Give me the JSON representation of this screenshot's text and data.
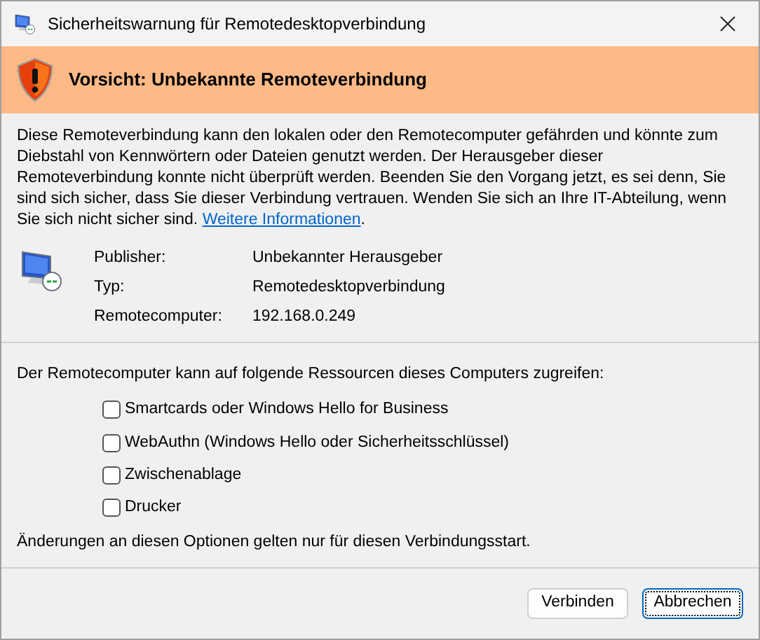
{
  "window": {
    "title": "Sicherheitswarnung für Remotedesktopverbindung"
  },
  "banner": {
    "text": "Vorsicht: Unbekannte Remoteverbindung"
  },
  "description": {
    "text": "Diese Remoteverbindung kann den lokalen oder den Remotecomputer gefährden und könnte zum Diebstahl von Kennwörtern oder Dateien genutzt werden. Der Herausgeber dieser Remoteverbindung konnte nicht überprüft werden. Beenden Sie den Vorgang jetzt, es sei denn, Sie sind sich sicher, dass Sie dieser Verbindung vertrauen. Wenden Sie sich an Ihre IT-Abteilung, wenn Sie sich nicht sicher sind.",
    "link": "Weitere Informationen",
    "after_link": "."
  },
  "details": [
    {
      "label": "Publisher:",
      "value": "Unbekannter Herausgeber"
    },
    {
      "label": "Typ:",
      "value": "Remotedesktopverbindung"
    },
    {
      "label": "Remotecomputer:",
      "value": "192.168.0.249"
    }
  ],
  "resources_label": "Der Remotecomputer kann auf folgende Ressourcen dieses Computers zugreifen:",
  "resources": [
    {
      "label": "Smartcards oder Windows Hello for Business",
      "checked": false
    },
    {
      "label": "WebAuthn (Windows Hello oder Sicherheitsschlüssel)",
      "checked": false
    },
    {
      "label": "Zwischenablage",
      "checked": false
    },
    {
      "label": "Drucker",
      "checked": false
    }
  ],
  "note": "Änderungen an diesen Optionen gelten nur für diesen Verbindungsstart.",
  "buttons": [
    {
      "label": "Verbinden",
      "selected": false
    },
    {
      "label": "Abbrechen",
      "selected": true
    }
  ]
}
